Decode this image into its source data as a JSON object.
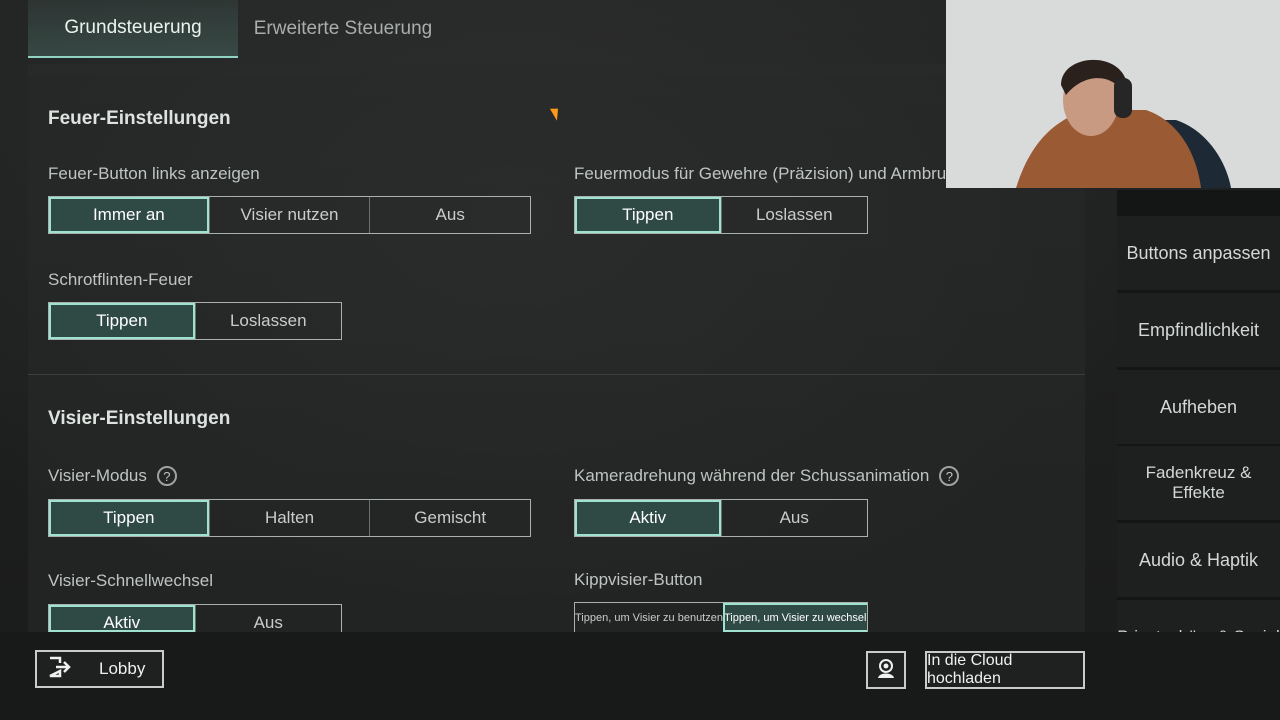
{
  "tabs": [
    {
      "label": "Grundsteuerung",
      "active": true
    },
    {
      "label": "Erweiterte Steuerung",
      "active": false
    }
  ],
  "fire": {
    "title": "Feuer-Einstellungen",
    "fire_button_left": {
      "label": "Feuer-Button links anzeigen",
      "options": [
        "Immer an",
        "Visier nutzen",
        "Aus"
      ],
      "selected": "Immer an"
    },
    "fire_mode": {
      "label": "Feuermodus für Gewehre (Präzision) und Armbrust",
      "options": [
        "Tippen",
        "Loslassen"
      ],
      "selected": "Tippen"
    },
    "shotgun": {
      "label": "Schrotflinten-Feuer",
      "options": [
        "Tippen",
        "Loslassen"
      ],
      "selected": "Tippen"
    }
  },
  "scope": {
    "title": "Visier-Einstellungen",
    "mode": {
      "label": "Visier-Modus",
      "help": "?",
      "options": [
        "Tippen",
        "Halten",
        "Gemischt"
      ],
      "selected": "Tippen"
    },
    "camera": {
      "label": "Kameradrehung während der Schussanimation",
      "help": "?",
      "options": [
        "Aktiv",
        "Aus"
      ],
      "selected": "Aktiv"
    },
    "quickswitch": {
      "label": "Visier-Schnellwechsel",
      "options": [
        "Aktiv",
        "Aus"
      ],
      "selected": "Aktiv"
    },
    "tilt": {
      "label": "Kippvisier-Button",
      "options": [
        "Tippen, um Visier zu benutzen",
        "Tippen, um Visier zu wechseln"
      ],
      "selected": "Tippen, um Visier zu wechseln"
    }
  },
  "sidebar": {
    "items": [
      "Buttons anpassen",
      "Empfindlichkeit",
      "Aufheben",
      "Fadenkreuz & Effekte",
      "Audio & Haptik",
      "Privatsphäre & Social"
    ]
  },
  "bottom": {
    "lobby": "Lobby",
    "cloud": "In die Cloud hochladen"
  },
  "colors": {
    "accent": "#9fe3cf",
    "selected_bg": "#2f4a45"
  }
}
